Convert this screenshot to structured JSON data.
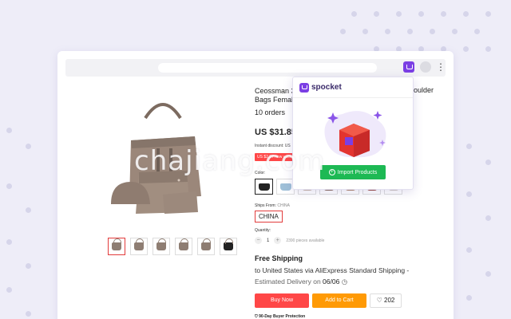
{
  "product": {
    "title_line1": "Ceossman 3",
    "title_line1_end": "oulder",
    "title_line2": "Bags Female",
    "orders": "10 orders",
    "price": "US $31.85",
    "instant_discount": "Instant discount: US",
    "promo": "US $2.87 new user",
    "color_label": "Color:",
    "ships_from_label": "Ships From:",
    "ships_from_value": "CHINA",
    "ships_from_selected": "CHINA",
    "quantity_label": "Quantity:",
    "quantity_value": "1",
    "available": "2390 pieces available",
    "free_shipping": "Free Shipping",
    "shipping_line": "to United States via AliExpress Standard Shipping -",
    "estimated_prefix": "Estimated Delivery on",
    "estimated_date": "06/06",
    "buy_now": "Buy Now",
    "add_to_cart": "Add to Cart",
    "wishlist_count": "202",
    "protection": "90-Day Buyer Protection"
  },
  "popup": {
    "brand": "spocket",
    "import_button": "Import Products"
  },
  "colors": {
    "accent": "#7b3fe4",
    "buy": "#ff4747",
    "cart": "#ff9a05",
    "import": "#1db954"
  },
  "watermark": "chajiang.com"
}
